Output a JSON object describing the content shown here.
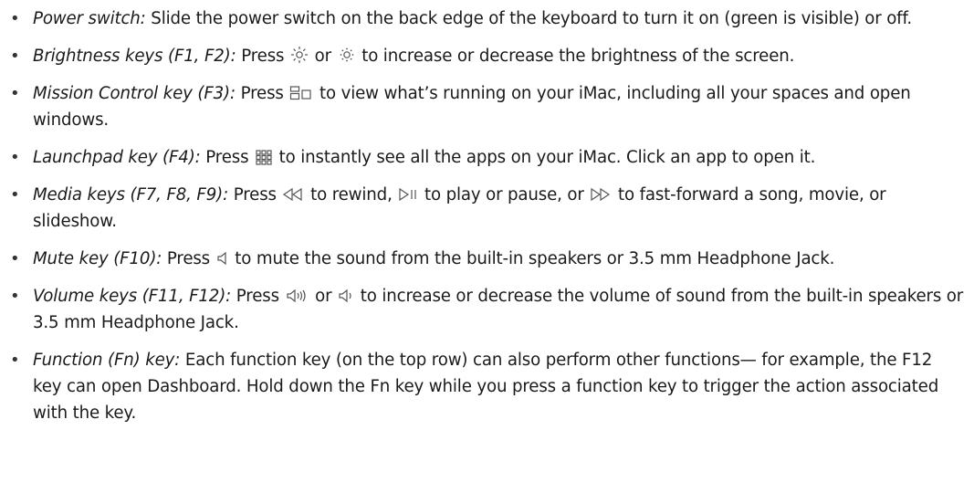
{
  "items": [
    {
      "term": "Power switch:",
      "parts": [
        " Slide the power switch on the back edge of the keyboard to turn it on (green is visible) or off."
      ]
    },
    {
      "term": "Brightness keys (F1, F2):",
      "parts": [
        " Press ",
        " or ",
        " to increase or decrease the brightness of the screen."
      ],
      "icons": [
        "brightness-up-icon",
        "brightness-down-icon"
      ]
    },
    {
      "term": "Mission Control key (F3):",
      "parts": [
        " Press ",
        " to view what’s running on your iMac, including all your spaces and open windows."
      ],
      "icons": [
        "mission-control-icon"
      ]
    },
    {
      "term": "Launchpad key (F4):",
      "parts": [
        " Press ",
        " to instantly see all the apps on your iMac. Click an app to open it."
      ],
      "icons": [
        "launchpad-icon"
      ]
    },
    {
      "term": "Media keys (F7, F8, F9):",
      "parts": [
        " Press ",
        " to rewind, ",
        " to play or pause, or ",
        " to fast-forward a song, movie, or slideshow."
      ],
      "icons": [
        "rewind-icon",
        "play-pause-icon",
        "fast-forward-icon"
      ]
    },
    {
      "term": "Mute key (F10):",
      "parts": [
        " Press ",
        " to mute the sound from the built-in speakers or 3.5 mm Headphone Jack."
      ],
      "icons": [
        "mute-icon"
      ]
    },
    {
      "term": "Volume keys (F11, F12):",
      "parts": [
        " Press ",
        " or ",
        " to increase or decrease the volume of sound from the built-in speakers or 3.5 mm Headphone Jack."
      ],
      "icons": [
        "volume-up-icon",
        "volume-down-icon"
      ]
    },
    {
      "term": "Function (Fn) key:",
      "parts": [
        " Each function key (on the top row) can also perform other functions— for example, the F12 key can open Dashboard. Hold down the Fn key while you press a function key to trigger the action associated with the key."
      ]
    }
  ]
}
